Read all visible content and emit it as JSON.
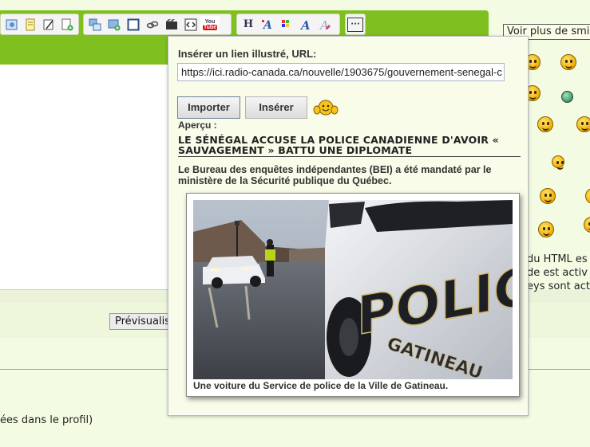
{
  "toolbar": {
    "buttons": [
      "insert-image-icon",
      "note-icon",
      "edit-icon",
      "add-file-icon",
      "image-left-icon",
      "image-add-icon",
      "frame-icon",
      "link-icon",
      "video-icon",
      "embed-code-icon",
      "youtube-icon",
      "heading-icon",
      "font-color-icon",
      "color-palette-icon",
      "font-style-icon",
      "clear-format-icon",
      "more-icon"
    ],
    "youtube_top": "You",
    "youtube_bottom": "Tube",
    "heading_glyph": "H",
    "more_glyph": "···",
    "accent_color": "#7fbf1f"
  },
  "preview_button": "Prévisualiser",
  "profile_text": "ées dans le profil)",
  "smileys": {
    "label": "Voir plus de smileys"
  },
  "right_info": {
    "line1": "du HTML es",
    "line2": "de est activ",
    "line3": "eys sont act"
  },
  "popup": {
    "url_label": "Insérer un lien illustré, URL:",
    "url_value": "https://ici.radio-canada.ca/nouvelle/1903675/gouvernement-senegal-c",
    "import_button": "Importer",
    "insert_button": "Insérer",
    "preview_label": "Aperçu :",
    "article_title": "LE SÉNÉGAL ACCUSE LA POLICE CANADIENNE D'AVOIR « SAUVAGEMENT » BATTU UNE DIPLOMATE",
    "article_description": "Le Bureau des enquêtes indépendantes (BEI) a été mandaté par le ministère de la Sécurité publique du Québec.",
    "image_caption": "Une voiture du Service de police de la Ville de Gatineau.",
    "car_text_police": "POLICE",
    "car_text_city": "GATINEAU"
  }
}
